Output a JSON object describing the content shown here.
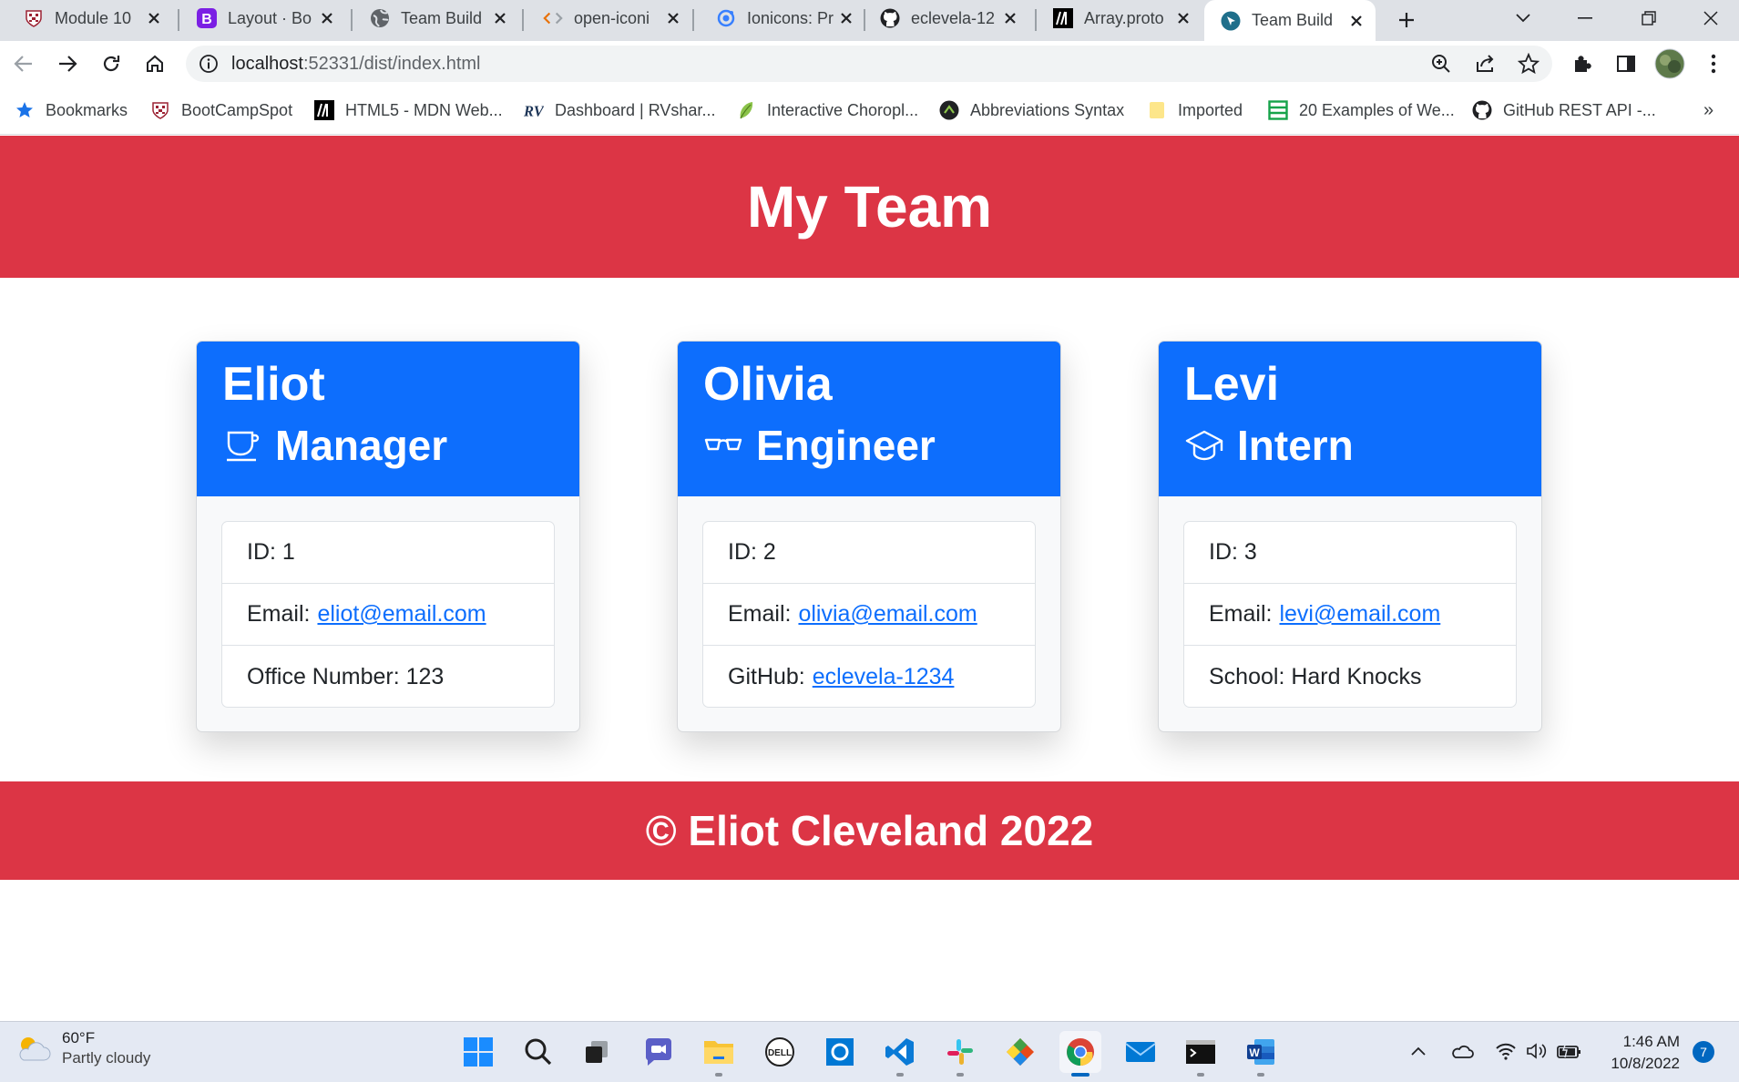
{
  "browser": {
    "tabs": [
      {
        "title": "Module 10",
        "icon": "shield-icon"
      },
      {
        "title": "Layout · Bo",
        "icon": "bootstrap-icon"
      },
      {
        "title": "Team Build",
        "icon": "globe-icon"
      },
      {
        "title": "open-iconi",
        "icon": "code-icon"
      },
      {
        "title": "Ionicons: Pr",
        "icon": "ionicons-icon"
      },
      {
        "title": "eclevela-12",
        "icon": "github-icon"
      },
      {
        "title": "Array.proto",
        "icon": "mdn-icon"
      },
      {
        "title": "Team Build",
        "icon": "team-builder-icon",
        "active": true
      }
    ],
    "url_host": "localhost",
    "url_rest": ":52331/dist/index.html",
    "bookmarks": [
      {
        "label": "Bookmarks",
        "icon": "star-icon"
      },
      {
        "label": "BootCampSpot",
        "icon": "shield-icon"
      },
      {
        "label": "HTML5 - MDN Web...",
        "icon": "mdn-icon"
      },
      {
        "label": "Dashboard | RVshar...",
        "icon": "rv-icon"
      },
      {
        "label": "Interactive Choropl...",
        "icon": "leaf-icon"
      },
      {
        "label": "Abbreviations Syntax",
        "icon": "emmet-icon"
      },
      {
        "label": "Imported",
        "icon": "folder-icon"
      },
      {
        "label": "20 Examples of We...",
        "icon": "layout-icon"
      },
      {
        "label": "GitHub REST API -...",
        "icon": "github-icon"
      }
    ],
    "overflow": "»"
  },
  "page": {
    "title": "My Team",
    "footer": "© Eliot Cleveland 2022",
    "cards": [
      {
        "name": "Eliot",
        "role": "Manager",
        "role_icon": "cafe-icon",
        "id_label": "ID: 1",
        "email_label": "Email:",
        "email": "eliot@email.com",
        "extra_label": "Office Number: 123",
        "extra_link": ""
      },
      {
        "name": "Olivia",
        "role": "Engineer",
        "role_icon": "glasses-icon",
        "id_label": "ID: 2",
        "email_label": "Email:",
        "email": "olivia@email.com",
        "extra_label": "GitHub:",
        "extra_link": "eclevela-1234"
      },
      {
        "name": "Levi",
        "role": "Intern",
        "role_icon": "graduation-cap-icon",
        "id_label": "ID: 3",
        "email_label": "Email:",
        "email": "levi@email.com",
        "extra_label": "School: Hard Knocks",
        "extra_link": ""
      }
    ]
  },
  "taskbar": {
    "weather": {
      "temp": "60°F",
      "condition": "Partly cloudy"
    },
    "apps": [
      "windows-start",
      "search",
      "task-view",
      "teams-chat",
      "file-explorer",
      "dell",
      "cortana",
      "vscode",
      "slack",
      "git",
      "chrome",
      "mail",
      "terminal",
      "word"
    ],
    "time": "1:46 AM",
    "date": "10/8/2022",
    "notifications": "7"
  },
  "colors": {
    "header_red": "#dc3545",
    "card_blue": "#0d6efd",
    "link_blue": "#0d6efd"
  }
}
